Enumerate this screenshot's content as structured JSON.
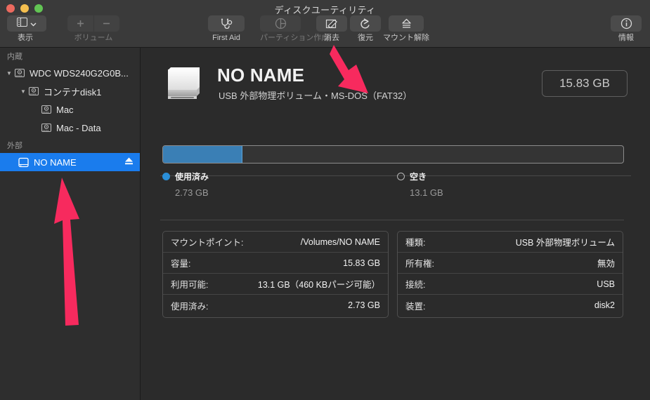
{
  "window": {
    "title": "ディスクユーティリティ",
    "traffic_lights": [
      "close",
      "minimize",
      "zoom"
    ],
    "accent_color": "#1a7ced",
    "annotation_color": "#f72a5e"
  },
  "toolbar": {
    "view": {
      "label": "表示",
      "icon": "sidebar-layout-icon",
      "chevron": "chevron-down-icon",
      "enabled": true
    },
    "volume": {
      "label": "ボリューム",
      "add_icon": "plus-icon",
      "remove_icon": "minus-icon",
      "enabled": false
    },
    "items": [
      {
        "id": "first-aid",
        "label": "First Aid",
        "icon": "stethoscope-icon",
        "enabled": true
      },
      {
        "id": "partition",
        "label": "パーティション作成",
        "icon": "pie-chart-icon",
        "enabled": false
      },
      {
        "id": "erase",
        "label": "消去",
        "icon": "erase-pencil-icon",
        "enabled": true
      },
      {
        "id": "restore",
        "label": "復元",
        "icon": "undo-arrow-icon",
        "enabled": true
      },
      {
        "id": "unmount",
        "label": "マウント解除",
        "icon": "eject-icon",
        "enabled": true
      }
    ],
    "info": {
      "label": "情報",
      "icon": "info-circle-icon",
      "enabled": true
    }
  },
  "sidebar": {
    "sections": [
      {
        "header": "内蔵",
        "rows": [
          {
            "label": "WDC WDS240G2G0B...",
            "icon": "hard-disk-icon",
            "indent": 0,
            "twisty": "▼",
            "selected": false,
            "eject": false
          },
          {
            "label": "コンテナdisk1",
            "icon": "hard-disk-icon",
            "indent": 1,
            "twisty": "▼",
            "selected": false,
            "eject": false
          },
          {
            "label": "Mac",
            "icon": "hard-disk-icon",
            "indent": 2,
            "twisty": "",
            "selected": false,
            "eject": false
          },
          {
            "label": "Mac - Data",
            "icon": "hard-disk-icon",
            "indent": 2,
            "twisty": "",
            "selected": false,
            "eject": false
          }
        ]
      },
      {
        "header": "外部",
        "rows": [
          {
            "label": "NO NAME",
            "icon": "external-drive-icon",
            "indent": 0,
            "twisty": "",
            "selected": true,
            "eject": true
          }
        ]
      }
    ]
  },
  "main": {
    "volume_name": "NO NAME",
    "volume_subtitle": "USB 外部物理ボリューム・MS-DOS（FAT32）",
    "capacity_badge": "15.83 GB",
    "drive_icon": "external-drive-large-icon",
    "usage": {
      "used_percent": 17.2,
      "used": {
        "label": "使用済み",
        "value": "2.73 GB",
        "color": "#2b8fd8",
        "selected": true
      },
      "free": {
        "label": "空き",
        "value": "13.1 GB",
        "color": "#b9b9b9",
        "selected": false
      }
    },
    "info_left": [
      {
        "key": "マウントポイント:",
        "value": "/Volumes/NO NAME"
      },
      {
        "key": "容量:",
        "value": "15.83 GB"
      },
      {
        "key": "利用可能:",
        "value": "13.1 GB（460 KBパージ可能）"
      },
      {
        "key": "使用済み:",
        "value": "2.73 GB"
      }
    ],
    "info_right": [
      {
        "key": "種類:",
        "value": "USB 外部物理ボリューム"
      },
      {
        "key": "所有権:",
        "value": "無効"
      },
      {
        "key": "接続:",
        "value": "USB"
      },
      {
        "key": "装置:",
        "value": "disk2"
      }
    ]
  }
}
